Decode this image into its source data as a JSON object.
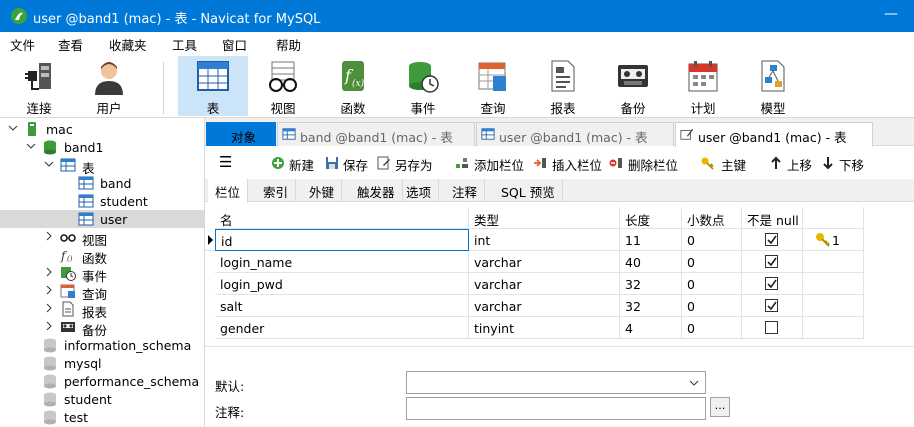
{
  "window": {
    "title": "user @band1 (mac) - 表 - Navicat for MySQL",
    "minimize_glyph": "—"
  },
  "menu": [
    "文件",
    "查看",
    "收藏夹",
    "工具",
    "窗口",
    "帮助"
  ],
  "toolbar": [
    {
      "label": "连接",
      "icon": "plug-icon"
    },
    {
      "label": "用户",
      "icon": "user-icon"
    },
    {
      "label": "表",
      "icon": "table-icon",
      "active": true
    },
    {
      "label": "视图",
      "icon": "glasses-icon"
    },
    {
      "label": "函数",
      "icon": "function-icon"
    },
    {
      "label": "事件",
      "icon": "event-icon"
    },
    {
      "label": "查询",
      "icon": "query-icon"
    },
    {
      "label": "报表",
      "icon": "report-icon"
    },
    {
      "label": "备份",
      "icon": "backup-icon"
    },
    {
      "label": "计划",
      "icon": "calendar-icon"
    },
    {
      "label": "模型",
      "icon": "model-icon"
    }
  ],
  "tree": {
    "connection": "mac",
    "database": "band1",
    "tables_folder": "表",
    "tables": [
      "band",
      "student",
      "user"
    ],
    "selected_table": "user",
    "folders": [
      "视图",
      "函数",
      "事件",
      "查询",
      "报表",
      "备份"
    ],
    "other_databases": [
      "information_schema",
      "mysql",
      "performance_schema",
      "student",
      "test"
    ]
  },
  "tabs": [
    {
      "label": "对象"
    },
    {
      "label": "band @band1 (mac) - 表"
    },
    {
      "label": "user @band1 (mac) - 表"
    },
    {
      "label": "user @band1 (mac) - 表"
    }
  ],
  "editor_toolbar": {
    "menu_glyph": "☰",
    "new": "新建",
    "save": "保存",
    "save_as": "另存为",
    "add_column": "添加栏位",
    "insert_column": "插入栏位",
    "delete_column": "删除栏位",
    "primary_key": "主键",
    "move_up": "上移",
    "move_down": "下移"
  },
  "subtabs": [
    "栏位",
    "索引",
    "外键",
    "触发器",
    "选项",
    "注释",
    "SQL 预览"
  ],
  "grid": {
    "headers": {
      "name": "名",
      "type": "类型",
      "length": "长度",
      "decimals": "小数点",
      "not_null": "不是 null"
    },
    "rows": [
      {
        "name": "id",
        "type": "int",
        "length": "11",
        "decimals": "0",
        "not_null": true,
        "key": "1"
      },
      {
        "name": "login_name",
        "type": "varchar",
        "length": "40",
        "decimals": "0",
        "not_null": true,
        "key": ""
      },
      {
        "name": "login_pwd",
        "type": "varchar",
        "length": "32",
        "decimals": "0",
        "not_null": true,
        "key": ""
      },
      {
        "name": "salt",
        "type": "varchar",
        "length": "32",
        "decimals": "0",
        "not_null": true,
        "key": ""
      },
      {
        "name": "gender",
        "type": "tinyint",
        "length": "4",
        "decimals": "0",
        "not_null": false,
        "key": ""
      }
    ]
  },
  "bottom": {
    "default_label": "默认:",
    "default_value": "",
    "comment_label": "注释:",
    "comment_value": "",
    "browse_label": "..."
  },
  "colors": {
    "accent": "#0078d7",
    "selection": "#cce4f7",
    "key": "#e6b800"
  }
}
